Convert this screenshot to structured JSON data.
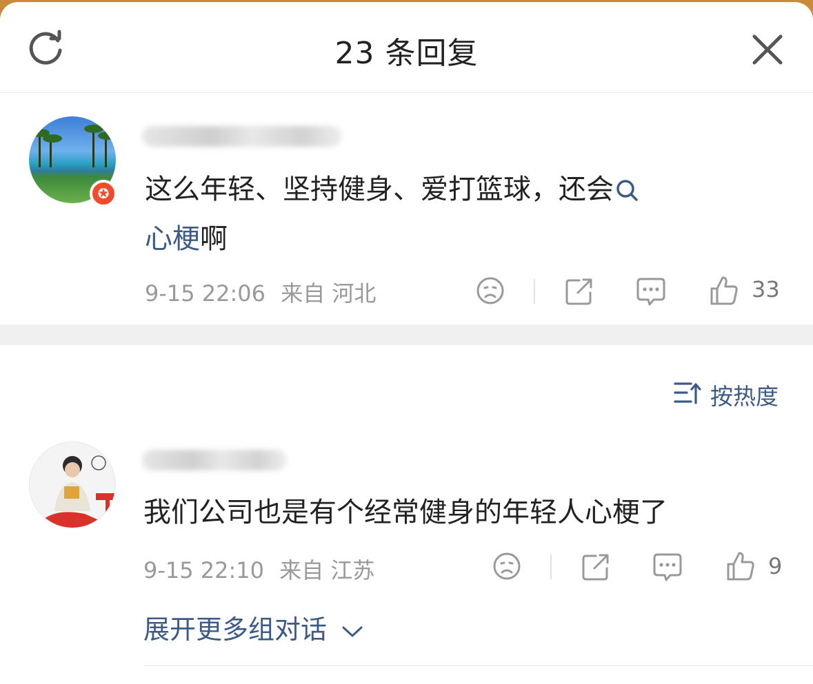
{
  "header": {
    "title": "23 条回复",
    "refresh_icon": "refresh-icon",
    "close_icon": "close-icon"
  },
  "root_comment": {
    "text": "这么年轻、坚持健身、爱打篮球，还会",
    "linked_text": "心梗",
    "trailing_text": "啊",
    "time": "9-15 22:06",
    "source": "来自 河北",
    "likes": "33",
    "badge_icon": "star-badge-icon"
  },
  "sort": {
    "label": "按热度",
    "icon": "sort-icon"
  },
  "replies": [
    {
      "text": "我们公司也是有个经常健身的年轻人心梗了",
      "time": "9-15 22:10",
      "source": "来自 江苏",
      "likes": "9"
    }
  ],
  "expand_label": "展开更多组对话",
  "colors": {
    "link": "#3b5a86",
    "meta": "#999999",
    "badge": "#f24b2c"
  }
}
